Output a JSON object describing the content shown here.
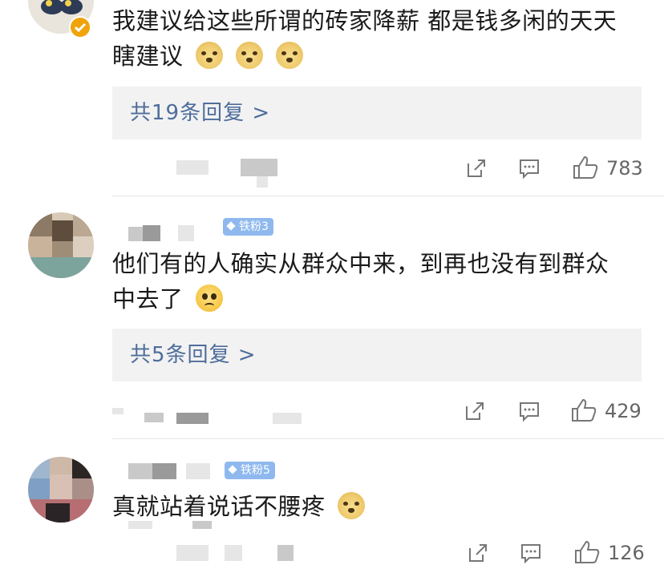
{
  "comments": [
    {
      "text_line1": "我建议给这些所谓的砖家降薪 都是钱多闲的天天",
      "text_line2": "瞎建议",
      "replies_label": "共19条回复 >",
      "likes": "783",
      "emojis": [
        "doge",
        "doge",
        "doge"
      ]
    },
    {
      "badge": "铁粉3",
      "text_line1": "他们有的人确实从群众中来，到再也没有到群众",
      "text_line2": "中去了",
      "replies_label": "共5条回复 >",
      "likes": "429",
      "emojis": [
        "sad"
      ]
    },
    {
      "badge": "铁粉5",
      "text_line1": "真就站着说话不腰疼",
      "likes": "126",
      "emojis": [
        "doge"
      ]
    }
  ],
  "icons": {
    "share": "share-icon",
    "comment": "comment-icon",
    "like": "thumbs-up-icon",
    "verified": "verified-badge-icon"
  },
  "colors": {
    "link": "#4e6d9b",
    "badge": "#8fb9ee",
    "verified": "#f0a30a"
  }
}
